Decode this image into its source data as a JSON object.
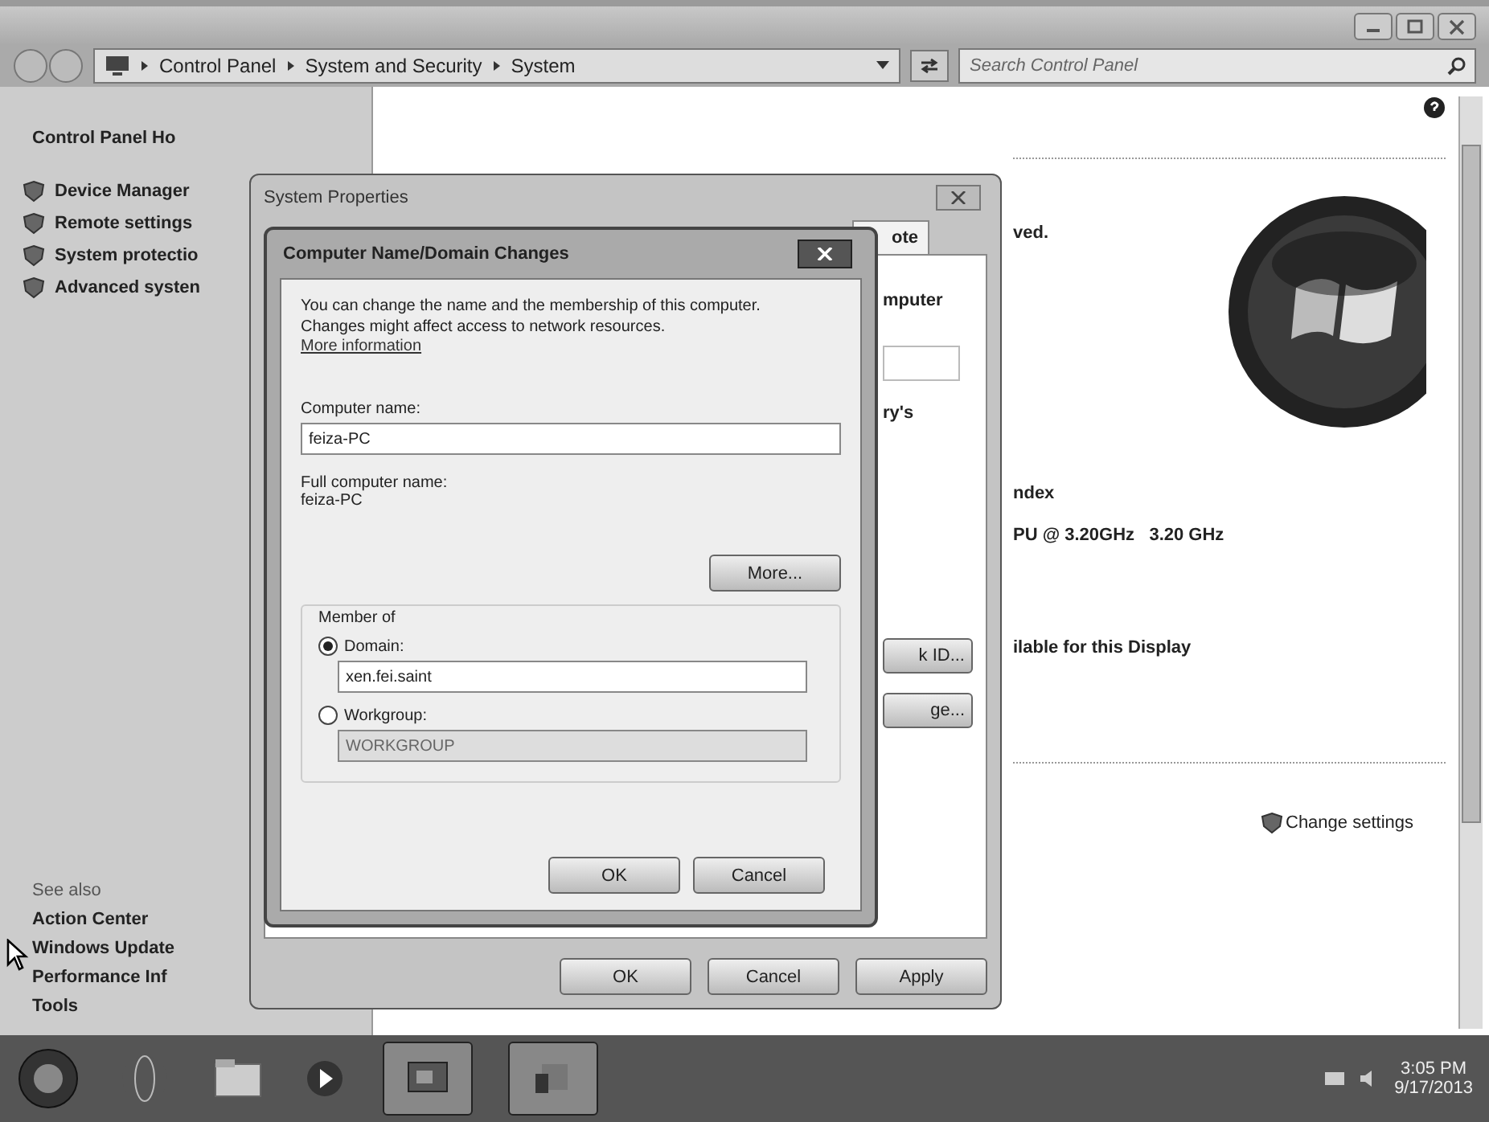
{
  "window": {
    "address_path": [
      "Control Panel",
      "System and Security",
      "System"
    ],
    "search": {
      "placeholder": "Search Control Panel"
    }
  },
  "sidebar": {
    "home_link": "Control Panel Ho",
    "tasks": [
      "Device Manager",
      "Remote settings",
      "System protectio",
      "Advanced systen"
    ],
    "see_also_heading": "See also",
    "see_also": [
      "Action Center",
      "Windows Update",
      "Performance Inf",
      "Tools"
    ]
  },
  "content": {
    "fragments": [
      "ved.",
      "ndex",
      "PU @ 3.20GHz   3.20 GHz",
      "ilable for this Display"
    ],
    "change_settings": "Change settings"
  },
  "system_properties": {
    "title": "System Properties",
    "tab": "ote",
    "fragments": [
      "mputer",
      "ry's"
    ],
    "panel_buttons": [
      "k ID...",
      "ge..."
    ],
    "buttons": [
      "OK",
      "Cancel",
      "Apply"
    ]
  },
  "name_dialog": {
    "title": "Computer Name/Domain Changes",
    "description": "You can change the name and the membership of this computer. Changes might affect access to network resources.",
    "link": "More information",
    "computer_name_label": "Computer name:",
    "computer_name": "feiza-PC",
    "full_name_label": "Full computer name:",
    "full_name": "feiza-PC",
    "more_button": "More...",
    "member_of": "Member of",
    "membership": [
      {
        "label": "Domain:",
        "selected": true,
        "value": "xen.fei.saint",
        "disabled": false
      },
      {
        "label": "Workgroup:",
        "selected": false,
        "value": "WORKGROUP",
        "disabled": true
      }
    ],
    "buttons": [
      "OK",
      "Cancel"
    ]
  },
  "taskbar": {
    "time": "3:05 PM",
    "date": "9/17/2013"
  }
}
